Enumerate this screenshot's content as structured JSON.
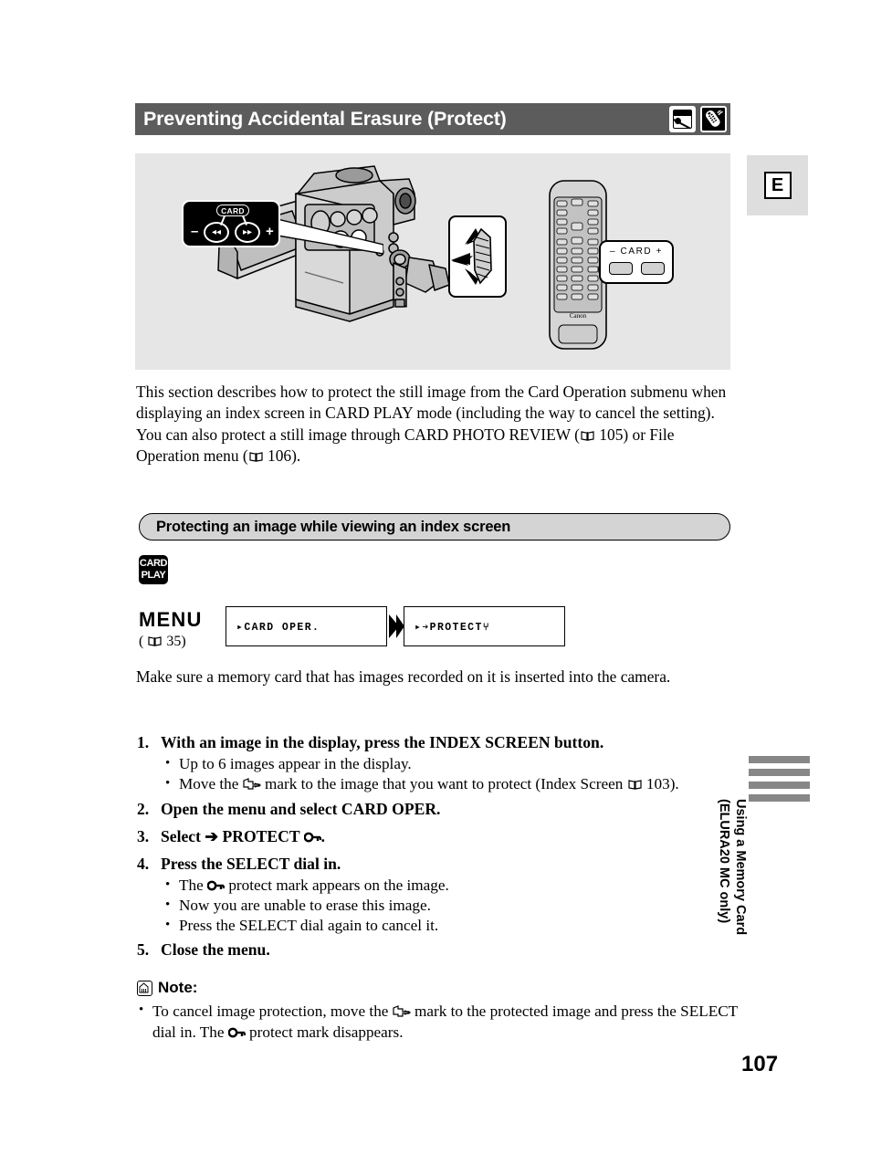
{
  "page": {
    "title": "Preventing Accidental Erasure (Protect)",
    "number": "107",
    "edition_marker": "E",
    "side_tab_line1": "Using a Memory Card",
    "side_tab_line2": "(ELURA20 MC only)"
  },
  "title_icons": [
    {
      "name": "memory-card-icon",
      "label": "Memory Card"
    },
    {
      "name": "wireless-controller-icon",
      "label": "Wireless Controller"
    }
  ],
  "illustration": {
    "lcd_callout": {
      "card_label": "CARD",
      "minus": "–",
      "plus": "+",
      "rewind_button": "◂◂",
      "forward_button": "▸▸"
    },
    "remote_callout": {
      "label": "–  CARD  +"
    }
  },
  "intro": {
    "paragraph1": "This section describes how to protect the still image from the Card Operation submenu when displaying an index screen in CARD PLAY mode (including the way to cancel the setting).",
    "paragraph2_a": "You can also protect a still image through CARD PHOTO REVIEW (",
    "paragraph2_page1": "105",
    "paragraph2_b": ") or File Operation menu (",
    "paragraph2_page2": "106",
    "paragraph2_c": ")."
  },
  "subsection": {
    "header": "Protecting an image while viewing an index screen",
    "mode_badge_line1": "CARD",
    "mode_badge_line2": "PLAY"
  },
  "menu_flow": {
    "label": "MENU",
    "ref_open": "(",
    "ref_page": "35",
    "ref_close": ")",
    "box1": "▸CARD OPER.",
    "box2": "▸➔PROTECT⑂"
  },
  "preparation": "Make sure a memory card that has images recorded on it is inserted into the camera.",
  "steps": [
    {
      "num": "1.",
      "head": "With an image in the display, press the INDEX SCREEN button.",
      "bullets": [
        {
          "text": "Up to 6 images appear in the display."
        },
        {
          "text_a": "Move the",
          "symbol": "hand-pointer",
          "text_b": "mark to the image that you want to protect (Index Screen",
          "page": "103",
          "text_c": ")."
        }
      ]
    },
    {
      "num": "2.",
      "head": "Open the menu and select CARD OPER.",
      "bullets": []
    },
    {
      "num": "3.",
      "head_a": "Select",
      "head_arrow": "➔",
      "head_b": "PROTECT",
      "head_symbol": "key",
      "head_c": ".",
      "bullets": []
    },
    {
      "num": "4.",
      "head": "Press the SELECT dial in.",
      "bullets": [
        {
          "text_a": "The",
          "symbol": "key",
          "text_b": "protect mark appears on the image."
        },
        {
          "text": "Now you are unable to erase this image."
        },
        {
          "text": "Press the SELECT dial again to cancel it."
        }
      ]
    },
    {
      "num": "5.",
      "head": "Close the menu.",
      "bullets": []
    }
  ],
  "note": {
    "title": "Note:",
    "body_a": "To cancel image protection, move the",
    "body_symbol1": "hand-pointer",
    "body_b": "mark to the protected image and press the SELECT dial in. The",
    "body_symbol2": "key",
    "body_c": "protect mark disappears."
  },
  "colors": {
    "title_bar": "#5c5c5c",
    "illustration_bg": "#e6e6e6",
    "subheader_bg": "#d4d4d4",
    "tab_gray": "#878787",
    "ebox_bg": "#dedede"
  }
}
